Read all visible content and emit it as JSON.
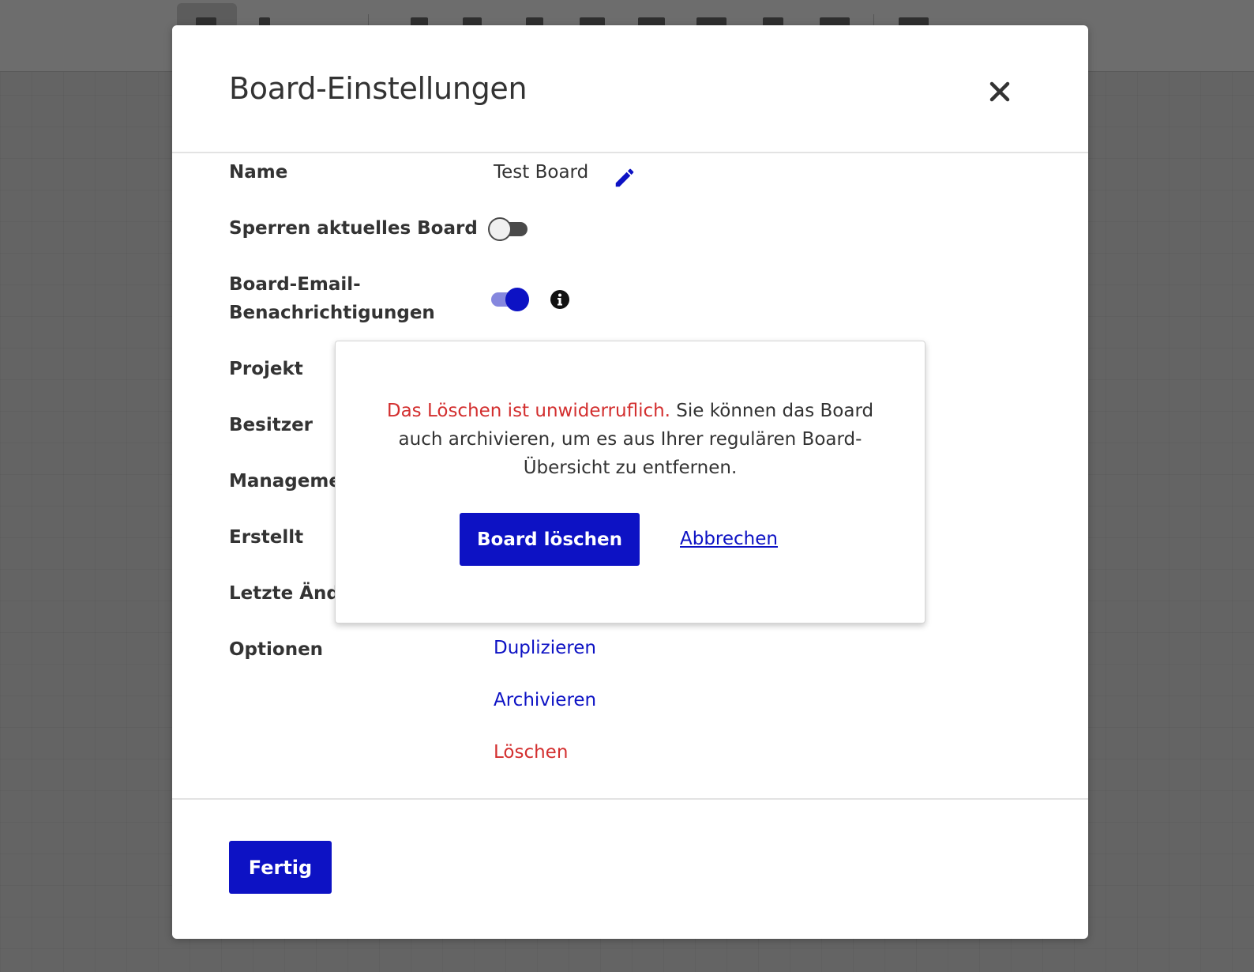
{
  "modal": {
    "title": "Board-Einstellungen",
    "close_icon": "close-icon"
  },
  "settings": {
    "name_label": "Name",
    "name_value": "Test Board",
    "lock_label": "Sperren aktuelles Board",
    "lock_enabled": false,
    "email_label_line1": "Board-Email-",
    "email_label_line2": "Benachrichtigungen",
    "email_enabled": true,
    "project_label": "Projekt",
    "owner_label": "Besitzer",
    "management_label": "Manageme",
    "created_label": "Erstellt",
    "last_change_label": "Letzte Ände",
    "options_label": "Optionen"
  },
  "options": {
    "duplicate": "Duplizieren",
    "archive": "Archivieren",
    "delete": "Löschen"
  },
  "footer": {
    "done_label": "Fertig"
  },
  "confirm_popover": {
    "warning": "Das Löschen ist unwiderruflich.",
    "message": " Sie können das Board auch archivieren, um es aus Ihrer regulären Board-Übersicht zu entfernen.",
    "delete_button": "Board löschen",
    "cancel_link": "Abbrechen"
  },
  "colors": {
    "accent": "#0d12c4",
    "danger": "#d32f2f",
    "toggle_on_track": "#8587de"
  }
}
